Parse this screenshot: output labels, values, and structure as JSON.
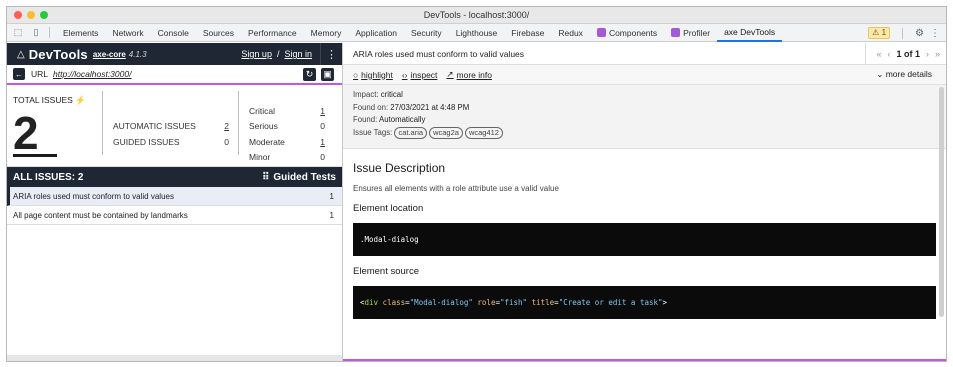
{
  "window": {
    "title": "DevTools - localhost:3000/",
    "traffic": [
      "#fe5f57",
      "#febc2e",
      "#28c840"
    ]
  },
  "tabs": [
    {
      "label": "Elements"
    },
    {
      "label": "Network"
    },
    {
      "label": "Console"
    },
    {
      "label": "Sources"
    },
    {
      "label": "Performance"
    },
    {
      "label": "Memory"
    },
    {
      "label": "Application"
    },
    {
      "label": "Security"
    },
    {
      "label": "Lighthouse"
    },
    {
      "label": "Firebase"
    },
    {
      "label": "Redux"
    },
    {
      "label": "Components"
    },
    {
      "label": "Profiler"
    },
    {
      "label": "axe DevTools"
    }
  ],
  "tabbar_right": {
    "warnings": "1"
  },
  "axe": {
    "title": "DevTools",
    "core_link": "axe-core",
    "version": "4.1.3",
    "sign_up": "Sign up",
    "separator": "/",
    "sign_in": "Sign in",
    "url_label": "URL",
    "url_value": "http://localhost:3000/",
    "total_label": "TOTAL ISSUES",
    "total": "2",
    "automatic_label": "AUTOMATIC ISSUES",
    "automatic": "2",
    "guided_label": "GUIDED ISSUES",
    "guided": "0",
    "critical_label": "Critical",
    "critical": "1",
    "serious_label": "Serious",
    "serious": "0",
    "moderate_label": "Moderate",
    "moderate": "1",
    "minor_label": "Minor",
    "minor": "0",
    "all_issues": "ALL ISSUES: 2",
    "guided_tests": "Guided Tests",
    "issues": [
      {
        "label": "ARIA roles used must conform to valid values",
        "count": "1"
      },
      {
        "label": "All page content must be contained by landmarks",
        "count": "1"
      }
    ]
  },
  "detail": {
    "title": "ARIA roles used must conform to valid values",
    "pager": "1 of 1",
    "highlight": "highlight",
    "inspect": "inspect",
    "more_info": "more info",
    "more_details": "more details",
    "impact_label": "Impact:",
    "impact": "critical",
    "found_on_label": "Found on:",
    "found_on": "27/03/2021 at 4:48 PM",
    "found_label": "Found:",
    "found": "Automatically",
    "tags_label": "Issue Tags:",
    "tags": [
      "cat.aria",
      "wcag2a",
      "wcag412"
    ],
    "desc_heading": "Issue Description",
    "desc": "Ensures all elements with a role attribute use a valid value",
    "location_heading": "Element location",
    "location": ".Modal-dialog",
    "source_heading": "Element source",
    "source": {
      "open": "<",
      "tag": "div",
      "attr1": "class",
      "val1": "\"Modal-dialog\"",
      "attr2": "role",
      "val2": "\"fish\"",
      "attr3": "title",
      "val3": "\"Create or edit a task\"",
      "close": ">"
    }
  }
}
